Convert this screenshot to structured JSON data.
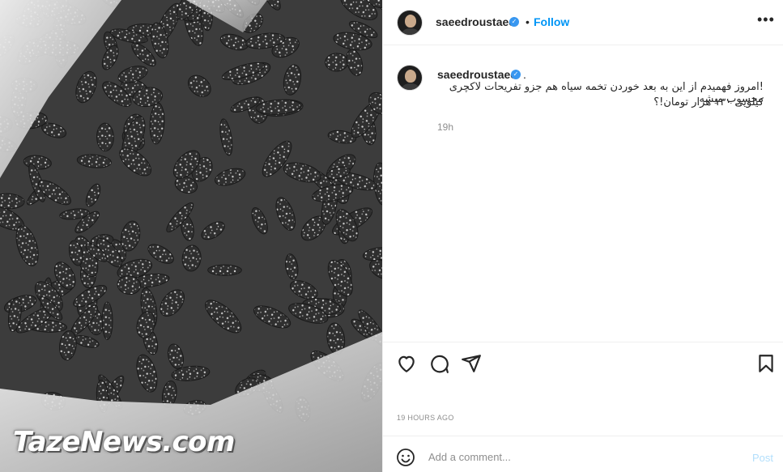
{
  "post": {
    "watermark": "TazeNews.com"
  },
  "header": {
    "username": "saeedroustaee",
    "verified_mark": "✓",
    "dot": "•",
    "follow_label": "Follow",
    "more_label": "•••"
  },
  "caption": {
    "username": "saeedroustaee",
    "verified_mark": "✓",
    "dot": ".",
    "line1": "!امروز فهمیدم از این به بعد خوردن تخمه سیاه هم جزو تفریحات لاکچری محسوب میشه",
    "line2": "کیلویی ۱۳۰ هزار تومان!؟",
    "time": "19h"
  },
  "actions": {
    "icons": [
      "heart-icon",
      "comment-icon",
      "share-icon",
      "bookmark-icon"
    ]
  },
  "posted_time": "19 HOURS AGO",
  "comment_box": {
    "placeholder": "Add a comment...",
    "post_label": "Post"
  },
  "colors": {
    "accent": "#0095f6",
    "verified": "#3897f0",
    "muted": "#8e8e8e",
    "post_disabled": "#b2dffc"
  }
}
